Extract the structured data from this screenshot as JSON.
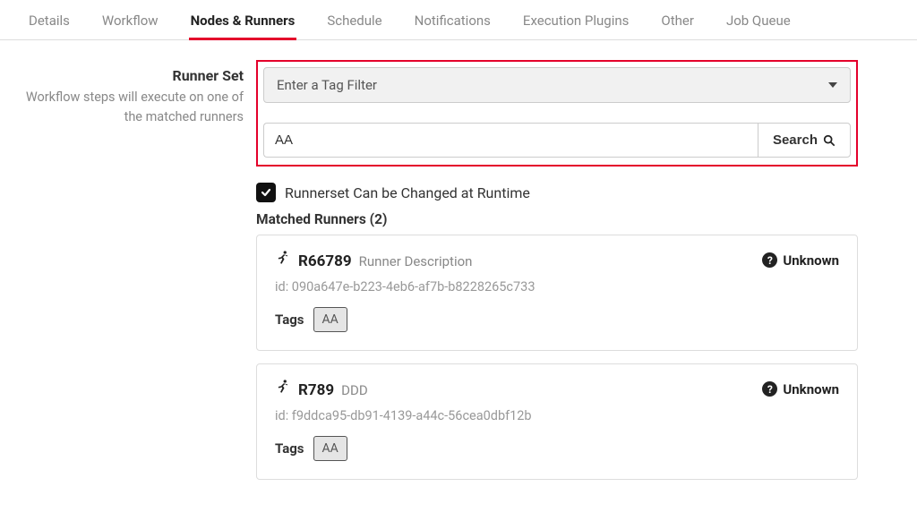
{
  "tabs": [
    {
      "label": "Details"
    },
    {
      "label": "Workflow"
    },
    {
      "label": "Nodes & Runners",
      "active": true
    },
    {
      "label": "Schedule"
    },
    {
      "label": "Notifications"
    },
    {
      "label": "Execution Plugins"
    },
    {
      "label": "Other"
    },
    {
      "label": "Job Queue"
    }
  ],
  "sidebar": {
    "heading": "Runner Set",
    "sub": "Workflow steps will execute on one of the matched runners"
  },
  "filter": {
    "placeholder": "Enter a Tag Filter"
  },
  "search": {
    "value": "AA",
    "button": "Search"
  },
  "runtime_checkbox": {
    "checked": true,
    "label": "Runnerset Can be Changed at Runtime"
  },
  "matched": {
    "heading": "Matched Runners (2)"
  },
  "runners": [
    {
      "name": "R66789",
      "desc": "Runner Description",
      "status": "Unknown",
      "id_label": "id: 090a647e-b223-4eb6-af7b-b8228265c733",
      "tags_label": "Tags",
      "tag": "AA"
    },
    {
      "name": "R789",
      "desc": "DDD",
      "status": "Unknown",
      "id_label": "id: f9ddca95-db91-4139-a44c-56cea0dbf12b",
      "tags_label": "Tags",
      "tag": "AA"
    }
  ]
}
